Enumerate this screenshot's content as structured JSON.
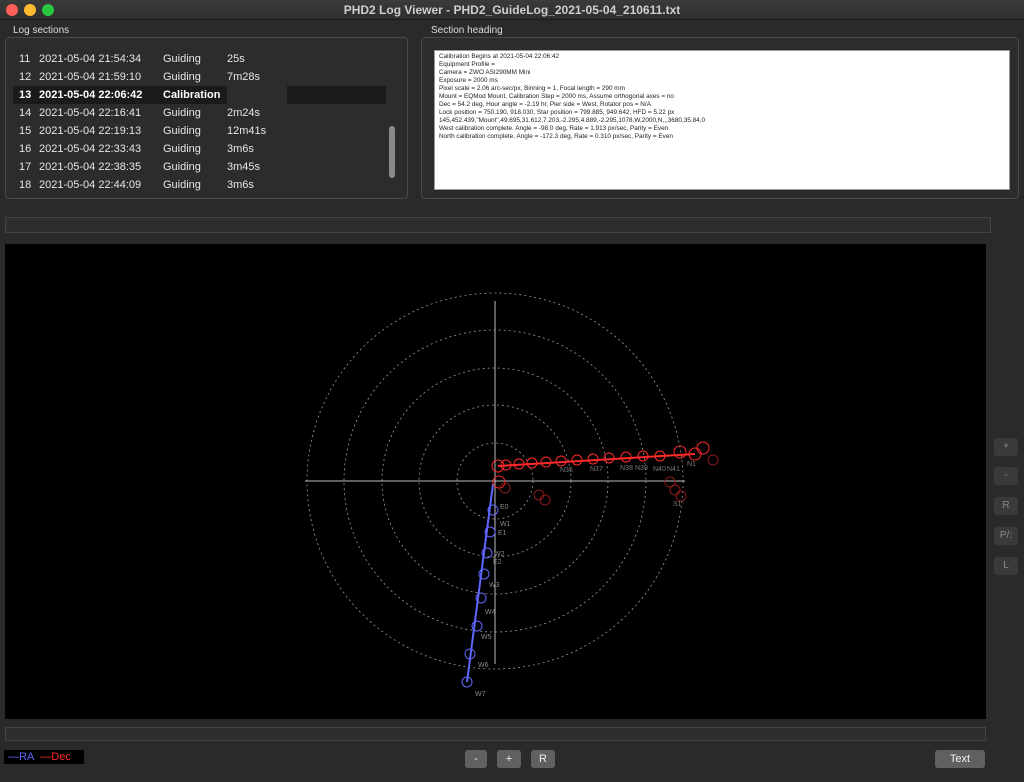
{
  "window": {
    "title": "PHD2 Log Viewer - PHD2_GuideLog_2021-05-04_210611.txt"
  },
  "log_sections": {
    "label": "Log sections",
    "rows": [
      {
        "n": "11",
        "ts": "2021-05-04 21:54:34",
        "type": "Guiding",
        "dur": "25s"
      },
      {
        "n": "12",
        "ts": "2021-05-04 21:59:10",
        "type": "Guiding",
        "dur": "7m28s"
      },
      {
        "n": "13",
        "ts": "2021-05-04 22:06:42",
        "type": "Calibration",
        "dur": ""
      },
      {
        "n": "14",
        "ts": "2021-05-04 22:16:41",
        "type": "Guiding",
        "dur": "2m24s"
      },
      {
        "n": "15",
        "ts": "2021-05-04 22:19:13",
        "type": "Guiding",
        "dur": "12m41s"
      },
      {
        "n": "16",
        "ts": "2021-05-04 22:33:43",
        "type": "Guiding",
        "dur": "3m6s"
      },
      {
        "n": "17",
        "ts": "2021-05-04 22:38:35",
        "type": "Guiding",
        "dur": "3m45s"
      },
      {
        "n": "18",
        "ts": "2021-05-04 22:44:09",
        "type": "Guiding",
        "dur": "3m6s"
      }
    ]
  },
  "section_heading": {
    "label": "Section heading",
    "lines": [
      "Calibration Begins at 2021-05-04 22:06:42",
      "Equipment Profile =",
      "Camera = ZWO ASI290MM Mini",
      "Exposure = 2000 ms",
      "Pixel scale = 2.06 arc-sec/px, Binning = 1, Focal length = 290 mm",
      "Mount = EQMod Mount, Calibration Step = 2000 ms, Assume orthogonal axes = no",
      "Dec = 54.2 deg, Hour angle = -2.19 hr, Pier side = West, Rotator pos = N/A",
      "Lock position = 750.190, 918.030, Star position = 799.885, 949.642, HFD = 5.22 px",
      "145,452.439,\"Mount\",49.695,31.612,7.203,-2.295,4.889,-2.295,1078,W,2000,N,,,3680,35.84,0",
      "West calibration complete. Angle = -98.0 deg, Rate = 1.913 px/sec, Parity = Even",
      "North calibration complete. Angle = -172.3 deg, Rate = 0.310 px/sec, Parity = Even"
    ]
  },
  "side_buttons": [
    "+",
    "-",
    "R",
    "P/:",
    "L"
  ],
  "legend": {
    "ra": "—RA",
    "dec": "—Dec"
  },
  "bottom_buttons": {
    "minus": "-",
    "plus": "+",
    "reset": "R",
    "text": "Text"
  },
  "colors": {
    "ra": "#5f67ff",
    "dec": "#ff2a2a",
    "background": "#000000"
  },
  "plot": {
    "ra_labels": [
      "W1",
      "E1",
      "W2",
      "E2",
      "W3",
      "W4",
      "W5",
      "W6",
      "W7",
      "E0"
    ],
    "dec_labels": [
      "N1",
      "N36",
      "N37",
      "N38",
      "N39",
      "N40",
      "N41",
      "S1"
    ]
  }
}
